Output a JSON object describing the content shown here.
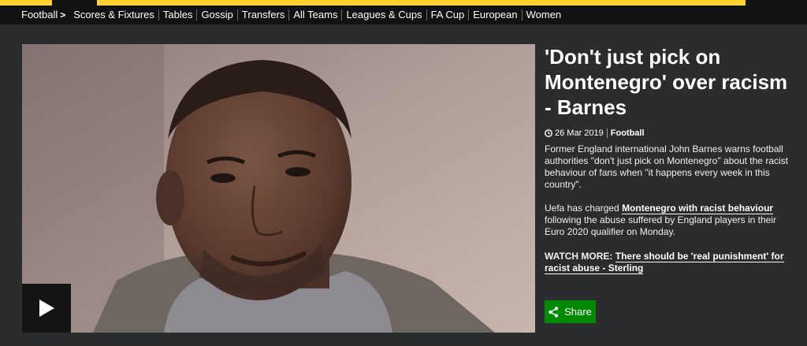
{
  "nav": {
    "items": [
      "Football",
      "Scores & Fixtures",
      "Tables",
      "Gossip",
      "Transfers",
      "All Teams",
      "Leagues & Cups",
      "FA Cup",
      "European",
      "Women"
    ],
    "chevron": ">"
  },
  "hero": {
    "icon": "play-icon",
    "colors": {
      "background": "#a08c88",
      "play_button": "#141414"
    }
  },
  "article": {
    "headline": "'Don't just pick on Montenegro' over racism - Barnes",
    "date": "26 Mar 2019",
    "topic": "Football",
    "para1": "Former England international John Barnes warns football authorities \"don't just pick on Montenegro\" about the racist behaviour of fans when \"it happens every week in this country\".",
    "para2_prefix": "Uefa has charged ",
    "para2_link": "Montenegro with racist behaviour",
    "para2_suffix": " following the abuse suffered by England players in their Euro 2020 qualifier on Monday.",
    "para3_prefix": "WATCH MORE: ",
    "para3_link": "There should be 'real punishment' for racist abuse - Sterling"
  },
  "share": {
    "label": "Share",
    "icon": "share-icon",
    "color": "#008a00"
  },
  "colors": {
    "accent": "#ffd230",
    "background": "#2b2c2d",
    "nav_bg": "#121212"
  }
}
